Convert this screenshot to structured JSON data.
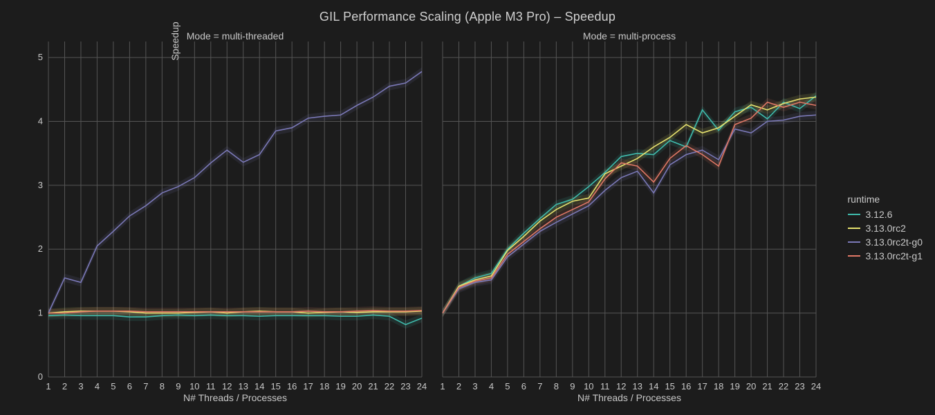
{
  "title": "GIL Performance Scaling (Apple M3 Pro) – Speedup",
  "facet_left_label": "Mode = multi-threaded",
  "facet_right_label": "Mode = multi-process",
  "xlabel": "N# Threads / Processes",
  "ylabel": "Speedup",
  "legend_title": "runtime",
  "chart_data": [
    {
      "type": "line",
      "title": "Mode = multi-threaded",
      "xlabel": "N# Threads / Processes",
      "ylabel": "Speedup",
      "ylim": [
        0,
        5.25
      ],
      "xlim": [
        1,
        24
      ],
      "x": [
        1,
        2,
        3,
        4,
        5,
        6,
        7,
        8,
        9,
        10,
        11,
        12,
        13,
        14,
        15,
        16,
        17,
        18,
        19,
        20,
        21,
        22,
        23,
        24
      ],
      "series": [
        {
          "name": "3.12.6",
          "color": "#3fbcad",
          "values": [
            0.96,
            0.97,
            0.96,
            0.96,
            0.96,
            0.94,
            0.94,
            0.96,
            0.97,
            0.96,
            0.97,
            0.96,
            0.96,
            0.95,
            0.96,
            0.96,
            0.96,
            0.96,
            0.95,
            0.95,
            0.97,
            0.95,
            0.82,
            0.92
          ]
        },
        {
          "name": "3.13.0rc2",
          "color": "#e7e36f",
          "values": [
            1.0,
            1.02,
            1.03,
            1.03,
            1.03,
            1.02,
            1.0,
            1.0,
            1.0,
            1.01,
            1.02,
            1.0,
            1.02,
            1.03,
            1.02,
            1.02,
            1.0,
            1.01,
            1.02,
            1.01,
            1.02,
            1.02,
            1.02,
            1.03
          ]
        },
        {
          "name": "3.13.0rc2t-g0",
          "color": "#7b79b8",
          "values": [
            1.0,
            1.55,
            1.48,
            2.05,
            2.28,
            2.52,
            2.68,
            2.88,
            2.98,
            3.12,
            3.35,
            3.55,
            3.36,
            3.48,
            3.85,
            3.9,
            4.05,
            4.08,
            4.1,
            4.25,
            4.38,
            4.55,
            4.6,
            4.78
          ]
        },
        {
          "name": "3.13.0rc2t-g1",
          "color": "#e17866",
          "values": [
            1.0,
            1.0,
            1.02,
            1.03,
            1.03,
            1.03,
            1.02,
            1.02,
            1.02,
            1.02,
            1.02,
            1.02,
            1.02,
            1.02,
            1.02,
            1.02,
            1.03,
            1.02,
            1.02,
            1.03,
            1.04,
            1.03,
            1.03,
            1.04
          ]
        }
      ]
    },
    {
      "type": "line",
      "title": "Mode = multi-process",
      "xlabel": "N# Threads / Processes",
      "ylabel": "",
      "ylim": [
        0,
        5.25
      ],
      "xlim": [
        1,
        24
      ],
      "x": [
        1,
        2,
        3,
        4,
        5,
        6,
        7,
        8,
        9,
        10,
        11,
        12,
        13,
        14,
        15,
        16,
        17,
        18,
        19,
        20,
        21,
        22,
        23,
        24
      ],
      "series": [
        {
          "name": "3.12.6",
          "color": "#3fbcad",
          "values": [
            1.0,
            1.42,
            1.55,
            1.62,
            2.0,
            2.25,
            2.48,
            2.7,
            2.78,
            2.98,
            3.2,
            3.45,
            3.5,
            3.48,
            3.7,
            3.6,
            4.18,
            3.86,
            4.15,
            4.22,
            4.04,
            4.3,
            4.2,
            4.4
          ]
        },
        {
          "name": "3.13.0rc2",
          "color": "#e7e36f",
          "values": [
            1.0,
            1.42,
            1.52,
            1.58,
            1.98,
            2.2,
            2.44,
            2.62,
            2.75,
            2.8,
            3.18,
            3.3,
            3.42,
            3.6,
            3.75,
            3.95,
            3.82,
            3.9,
            4.08,
            4.26,
            4.18,
            4.28,
            4.35,
            4.38
          ]
        },
        {
          "name": "3.13.0rc2t-g0",
          "color": "#7b79b8",
          "values": [
            1.0,
            1.38,
            1.48,
            1.52,
            1.88,
            2.08,
            2.28,
            2.42,
            2.55,
            2.68,
            2.92,
            3.12,
            3.22,
            2.88,
            3.32,
            3.48,
            3.55,
            3.4,
            3.88,
            3.82,
            4.0,
            4.02,
            4.08,
            4.1
          ]
        },
        {
          "name": "3.13.0rc2t-g1",
          "color": "#e17866",
          "values": [
            1.0,
            1.4,
            1.5,
            1.55,
            1.92,
            2.12,
            2.32,
            2.5,
            2.62,
            2.74,
            3.1,
            3.35,
            3.3,
            3.05,
            3.42,
            3.62,
            3.48,
            3.3,
            3.95,
            4.05,
            4.3,
            4.22,
            4.3,
            4.25
          ]
        }
      ]
    }
  ],
  "y_ticks": [
    0,
    1,
    2,
    3,
    4,
    5
  ],
  "x_ticks": [
    1,
    2,
    3,
    4,
    5,
    6,
    7,
    8,
    9,
    10,
    11,
    12,
    13,
    14,
    15,
    16,
    17,
    18,
    19,
    20,
    21,
    22,
    23,
    24
  ],
  "legend_items": [
    {
      "label": "3.12.6",
      "color": "#3fbcad"
    },
    {
      "label": "3.13.0rc2",
      "color": "#e7e36f"
    },
    {
      "label": "3.13.0rc2t-g0",
      "color": "#7b79b8"
    },
    {
      "label": "3.13.0rc2t-g1",
      "color": "#e17866"
    }
  ]
}
